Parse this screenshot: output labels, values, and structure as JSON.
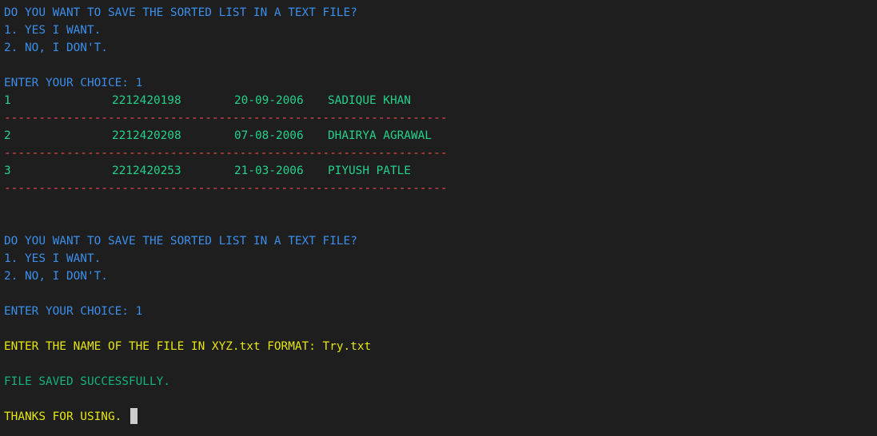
{
  "terminal": {
    "prompt1": {
      "question": "DO YOU WANT TO SAVE THE SORTED LIST IN A TEXT FILE?",
      "opt1": "1. YES I WANT.",
      "opt2": "2. NO, I DON'T.",
      "choice": "ENTER YOUR CHOICE: 1"
    },
    "rows": [
      {
        "no": "1",
        "id": "2212420198",
        "date": "20-09-2006",
        "name": "SADIQUE KHAN"
      },
      {
        "no": "2",
        "id": "2212420208",
        "date": "07-08-2006",
        "name": "DHAIRYA AGRAWAL"
      },
      {
        "no": "3",
        "id": "2212420253",
        "date": "21-03-2006",
        "name": "PIYUSH PATLE"
      }
    ],
    "separator": "----------------------------------------------------------------",
    "prompt2": {
      "question": "DO YOU WANT TO SAVE THE SORTED LIST IN A TEXT FILE?",
      "opt1": "1. YES I WANT.",
      "opt2": "2. NO, I DON'T.",
      "choice": "ENTER YOUR CHOICE: 1"
    },
    "filename_prompt": "ENTER THE NAME OF THE FILE IN XYZ.txt FORMAT: Try.txt",
    "saved_message": "FILE SAVED SUCCESSFULLY.",
    "thanks_message": "THANKS FOR USING. ",
    "colors": {
      "background": "#1e1e1e",
      "blue": "#3b8eea",
      "green": "#23d18b",
      "yellow": "#e5e510",
      "red": "#f14c4c"
    }
  }
}
